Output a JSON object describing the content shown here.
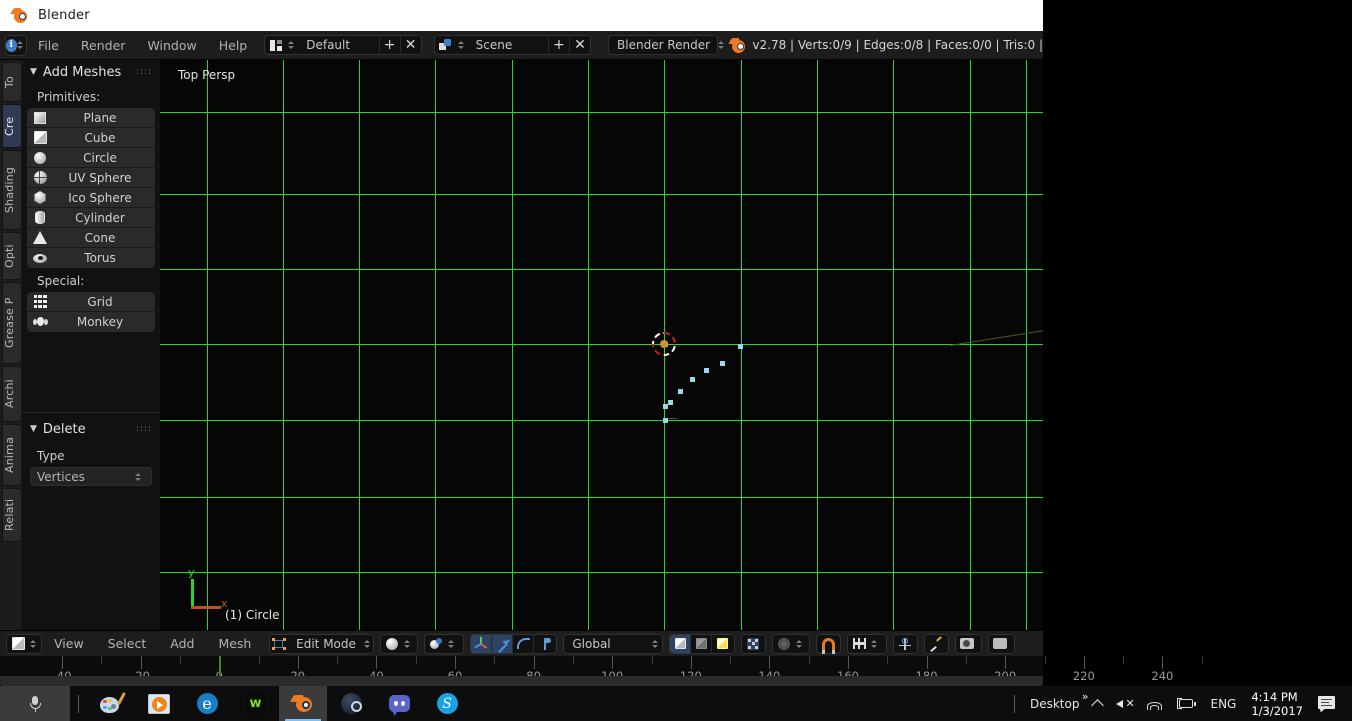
{
  "window": {
    "title": "Blender",
    "logo_icon": "blender-logo-icon"
  },
  "top_header": {
    "info_icon": "info-icon",
    "menus": [
      "File",
      "Render",
      "Window",
      "Help"
    ],
    "screen_layout": {
      "icon": "screen-layout-icon",
      "value": "Default",
      "add_label": "+",
      "delete_label": "✕"
    },
    "scene": {
      "icon": "scene-icon",
      "value": "Scene",
      "add_label": "+",
      "delete_label": "✕"
    },
    "render_engine": {
      "value": "Blender Render"
    },
    "stats": "v2.78 | Verts:0/9 | Edges:0/8 | Faces:0/0 | Tris:0 |"
  },
  "left_tabs": [
    {
      "label": "To",
      "active": false
    },
    {
      "label": "Cre",
      "active": true
    },
    {
      "label": "Shading",
      "active": false
    },
    {
      "label": "Opti",
      "active": false
    },
    {
      "label": "Grease P",
      "active": false
    },
    {
      "label": "Archi",
      "active": false
    },
    {
      "label": "Anima",
      "active": false
    },
    {
      "label": "Relati",
      "active": false
    }
  ],
  "tool_panel": {
    "add_meshes": {
      "title": "Add Meshes",
      "primitives_label": "Primitives:",
      "primitives": [
        {
          "label": "Plane",
          "icon": "plane-icon"
        },
        {
          "label": "Cube",
          "icon": "cube-icon"
        },
        {
          "label": "Circle",
          "icon": "circle-icon"
        },
        {
          "label": "UV Sphere",
          "icon": "uv-sphere-icon"
        },
        {
          "label": "Ico Sphere",
          "icon": "ico-sphere-icon"
        },
        {
          "label": "Cylinder",
          "icon": "cylinder-icon"
        },
        {
          "label": "Cone",
          "icon": "cone-icon"
        },
        {
          "label": "Torus",
          "icon": "torus-icon"
        }
      ],
      "special_label": "Special:",
      "special": [
        {
          "label": "Grid",
          "icon": "grid-icon"
        },
        {
          "label": "Monkey",
          "icon": "monkey-icon"
        }
      ]
    },
    "delete": {
      "title": "Delete",
      "type_label": "Type",
      "type_value": "Vertices"
    }
  },
  "viewport": {
    "view_label": "Top Persp",
    "object_label": "(1) Circle",
    "axis_x": "x",
    "axis_y": "y",
    "grid_color": "#2ad62a",
    "vertex_color": "#9cd9e8",
    "cursor_icon": "3d-cursor-icon"
  },
  "viewport_header": {
    "editor_type_icon": "editor-type-icon",
    "menus": [
      "View",
      "Select",
      "Add",
      "Mesh"
    ],
    "mode": {
      "icon": "edit-mode-icon",
      "value": "Edit Mode"
    },
    "viewport_shading_icon": "viewport-shading-icon",
    "shading_mode_icon": "shading-mode-icon",
    "manipulator_icons": [
      "translate-manipulator-icon",
      "rotate-manipulator-icon",
      "scale-manipulator-icon",
      "empty-manipulator-icon"
    ],
    "orientation": "Global",
    "select_mode_icons": [
      "vertex-select-icon",
      "edge-select-icon",
      "face-select-icon"
    ],
    "occlude_icon": "limit-selection-icon",
    "pivot_icon": "pivot-point-icon",
    "snap_icon": "snap-magnet-icon",
    "snap_target_icon": "snap-target-icon",
    "proportional_icon": "proportional-edit-icon",
    "mesh_options_icon": "mesh-options-icon",
    "render_icon": "render-icon",
    "render_anim_icon": "render-animation-icon"
  },
  "timeline": {
    "labels": [
      "-40",
      "-20",
      "0",
      "20",
      "40",
      "60",
      "80",
      "100",
      "120",
      "140",
      "160",
      "180",
      "200",
      "220",
      "240"
    ],
    "playhead_frame": "0"
  },
  "taskbar": {
    "cortana_icon": "microphone-icon",
    "apps": [
      {
        "name": "paint-icon",
        "active": false
      },
      {
        "name": "movies-tv-icon",
        "active": false
      },
      {
        "name": "edge-icon",
        "active": false
      },
      {
        "name": "vivaldi-icon",
        "active": false
      },
      {
        "name": "blender-icon",
        "active": true
      },
      {
        "name": "steam-icon",
        "active": false
      },
      {
        "name": "discord-icon",
        "active": false
      },
      {
        "name": "skype-icon",
        "active": false
      }
    ],
    "tray": {
      "desktop_label": "Desktop",
      "overflow_label": "»",
      "chevron_icon": "show-hidden-icons-icon",
      "volume_icon": "volume-muted-icon",
      "network_icon": "wifi-icon",
      "battery_icon": "battery-charging-icon",
      "language": "ENG",
      "time": "4:14 PM",
      "date": "1/3/2017",
      "notification_icon": "action-center-icon"
    }
  }
}
